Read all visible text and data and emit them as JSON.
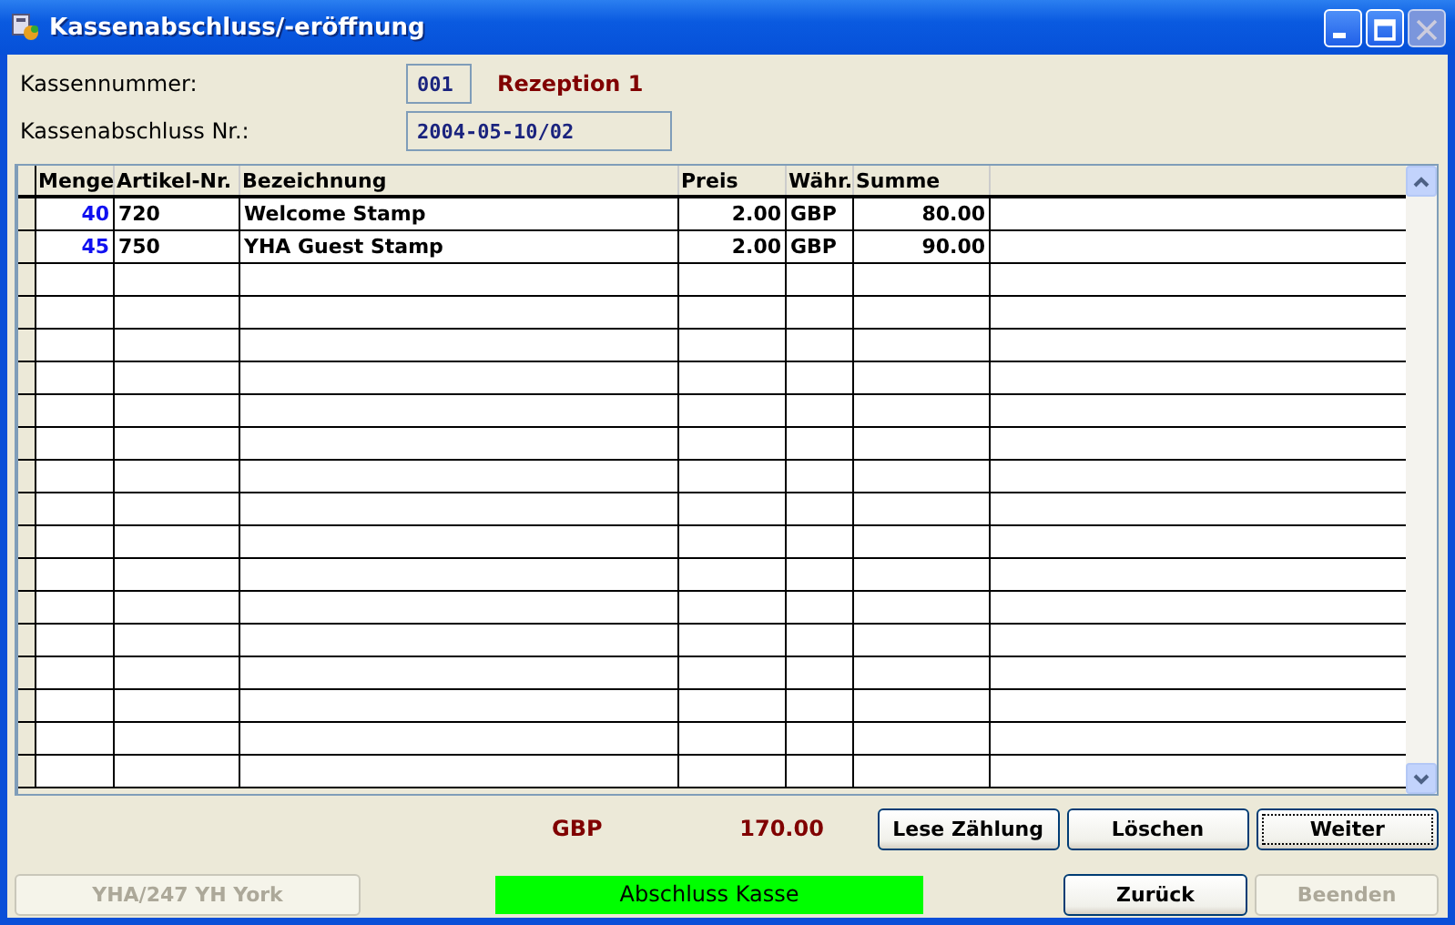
{
  "window": {
    "title": "Kassenabschluss/-eröffnung"
  },
  "register": {
    "label": "Kassennummer:",
    "number": "001",
    "name": "Rezeption 1"
  },
  "closing": {
    "label": "Kassenabschluss Nr.:",
    "value": "2004-05-10/02"
  },
  "table": {
    "columns": [
      "Menge",
      "Artikel-Nr.",
      "Bezeichnung",
      "Preis",
      "Währ.",
      "Summe"
    ],
    "rows": [
      {
        "cells": [
          "40",
          "720",
          "Welcome Stamp",
          "2.00",
          "GBP",
          "80.00"
        ]
      },
      {
        "cells": [
          "45",
          "750",
          "YHA Guest Stamp",
          "2.00",
          "GBP",
          "90.00"
        ]
      }
    ]
  },
  "total": {
    "currency": "GBP",
    "amount": "170.00"
  },
  "buttons": [
    {
      "label": "Lese Zählung",
      "disabled": false,
      "focused": false
    },
    {
      "label": "Löschen",
      "disabled": false,
      "focused": false
    },
    {
      "label": "Weiter",
      "disabled": false,
      "focused": true
    }
  ],
  "hostel_button": {
    "label": "YHA/247 YH York",
    "disabled": true
  },
  "status": {
    "text": "Abschluss Kasse",
    "color": "#00ff00"
  },
  "bottom_buttons": [
    {
      "label": "Zurück",
      "disabled": false,
      "focused": false
    },
    {
      "label": "Beenden",
      "disabled": true,
      "focused": false
    }
  ]
}
